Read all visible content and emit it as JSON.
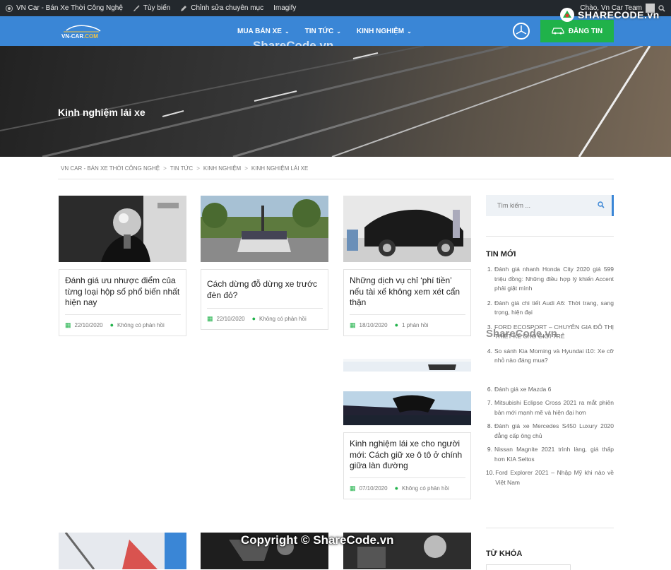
{
  "adminbar": {
    "site": "VN Car - Bán Xe Thời Công Nghệ",
    "customize": "Tùy biến",
    "edit": "Chỉnh sửa chuyên mục",
    "imagify": "Imagify",
    "greeting": "Chào, Vn Car Team"
  },
  "header": {
    "nav": [
      {
        "label": "MUA BÁN XE"
      },
      {
        "label": "TIN TỨC"
      },
      {
        "label": "KINH NGHIỆM"
      }
    ],
    "post_button": "ĐĂNG TIN",
    "watermark": "ShareCode.vn",
    "corner_logo": "SHARECODE.vn"
  },
  "hero": {
    "title": "Kinh nghiệm lái xe"
  },
  "breadcrumb": [
    "VN CAR - BÁN XE THỜI CÔNG NGHỆ",
    "TIN TỨC",
    "KINH NGHIỆM",
    "KINH NGHIỆM LÁI XE"
  ],
  "posts": [
    {
      "title": "Đánh giá ưu nhược điểm của từng loại hộp số phổ biến nhất hiện nay",
      "date": "22/10/2020",
      "comments": "Không có phản hồi"
    },
    {
      "title": "Cách dừng đỗ dừng xe trước đèn đỏ?",
      "date": "22/10/2020",
      "comments": "Không có phản hồi"
    },
    {
      "title": "Những dịch vụ chỉ ‘phí tiền’ nếu tài xế không xem xét cẩn thận",
      "date": "18/10/2020",
      "comments": "1 phản hồi"
    },
    {
      "title": "Kinh nghiệm lái xe cho người mới: Cách giữ xe ô tô ở chính giữa làn đường",
      "date": "07/10/2020",
      "comments": "Không có phản hồi"
    }
  ],
  "sidebar": {
    "search_placeholder": "Tìm kiếm ...",
    "news_heading": "TIN MỚI",
    "news": [
      "Đánh giá nhanh Honda City 2020 giá 599 triệu đồng: Những điều hợp lý khiến Accent phải giật mình",
      "Đánh giá chi tiết Audi A6: Thời trang, sang trọng, hiện đại",
      "FORD ECOSPORT – CHUYÊN GIA ĐÔ THỊ THIẾT KẾ CHO GIỚI TRẺ",
      "So sánh Kia Morning và Hyundai i10: Xe cỡ nhỏ nào đáng mua?",
      "",
      "Đánh giá xe Mazda 6",
      "Mitsubishi Eclipse Cross 2021 ra mắt phiên bản mới mạnh mẽ và hiện đại hơn",
      "Đánh giá xe Mercedes S450 Luxury 2020 đẳng cấp ông chủ",
      "Nissan Magnite 2021 trình làng, giá thấp hơn KIA Seltos",
      "Ford Explorer 2021 – Nhập Mỹ khi nào về Việt Nam"
    ],
    "keywords_heading": "TỪ KHÓA",
    "watermark": "ShareCode.vn"
  },
  "footer": {
    "copyright": "Copyright © ShareCode.vn"
  },
  "colors": {
    "primary": "#3a86d6",
    "green": "#20b24a",
    "adminbar": "#23282d"
  }
}
